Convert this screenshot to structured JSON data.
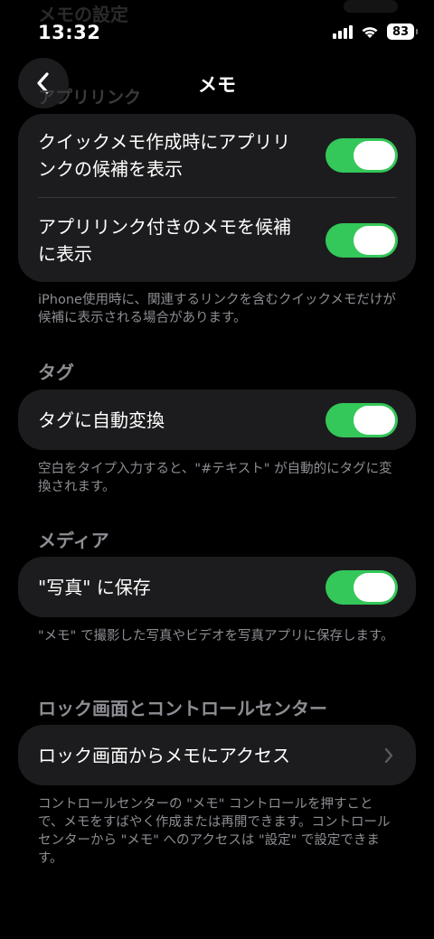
{
  "ghost_bar": {
    "left_text": "メモの設定"
  },
  "status_bar": {
    "time": "13:32",
    "battery": "83"
  },
  "nav": {
    "title": "メモ"
  },
  "ghost_header": "アプリリンク",
  "app_links": {
    "rows": [
      {
        "label": "クイックメモ作成時にアプリリンクの候補を表示",
        "on": true
      },
      {
        "label": "アプリリンク付きのメモを候補に表示",
        "on": true
      }
    ],
    "footer": "iPhone使用時に、関連するリンクを含むクイックメモだけが候補に表示される場合があります。"
  },
  "tags": {
    "header": "タグ",
    "rows": [
      {
        "label": "タグに自動変換",
        "on": true
      }
    ],
    "footer": "空白をタイプ入力すると、\"#テキスト\" が自動的にタグに変換されます。"
  },
  "media": {
    "header": "メディア",
    "rows": [
      {
        "label": "\"写真\" に保存",
        "on": true
      }
    ],
    "footer": "\"メモ\" で撮影した写真やビデオを写真アプリに保存します。"
  },
  "lock": {
    "header": "ロック画面とコントロールセンター",
    "rows": [
      {
        "label": "ロック画面からメモにアクセス"
      }
    ],
    "footer": "コントロールセンターの \"メモ\" コントロールを押すことで、メモをすばやく作成または再開できます。コントロールセンターから \"メモ\" へのアクセスは \"設定\" で設定できます。"
  },
  "colors": {
    "accent": "#34c759",
    "card": "#1c1c1e",
    "secondary_text": "#8d8d93"
  },
  "icons": [
    "chevron-left-icon",
    "signal-icon",
    "wifi-icon",
    "battery-icon",
    "chevron-right-icon"
  ]
}
